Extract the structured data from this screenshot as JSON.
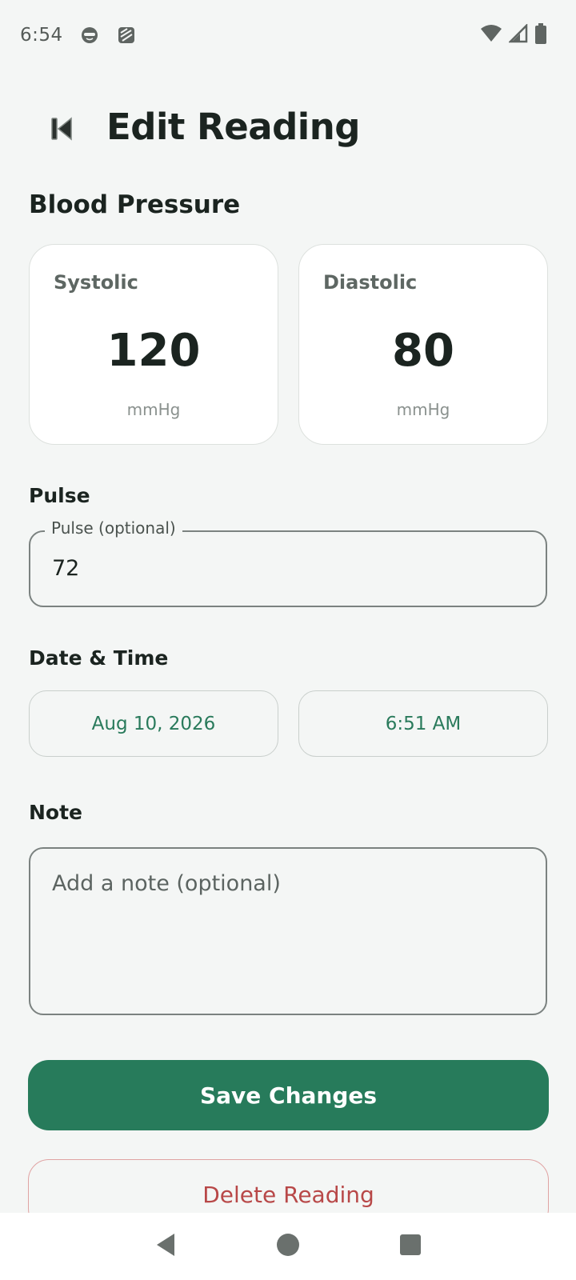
{
  "status_bar": {
    "time": "6:54",
    "notification_icons": [
      "face-notification-icon",
      "stack-notification-icon"
    ],
    "system_icons": [
      "wifi-icon",
      "cell-signal-icon",
      "battery-icon"
    ]
  },
  "header": {
    "back_icon": "skip-back-icon",
    "title": "Edit Reading"
  },
  "blood_pressure": {
    "section_label": "Blood Pressure",
    "systolic": {
      "label": "Systolic",
      "value": "120",
      "unit": "mmHg"
    },
    "diastolic": {
      "label": "Diastolic",
      "value": "80",
      "unit": "mmHg"
    }
  },
  "pulse": {
    "section_label": "Pulse",
    "field_label": "Pulse (optional)",
    "value": "72"
  },
  "date_time": {
    "section_label": "Date & Time",
    "date": "Aug 10, 2026",
    "time": "6:51 AM"
  },
  "note": {
    "section_label": "Note",
    "placeholder": "Add a note (optional)",
    "value": ""
  },
  "actions": {
    "save_label": "Save Changes",
    "delete_label": "Delete Reading"
  },
  "nav_bar": {
    "icons": [
      "back-triangle-icon",
      "home-circle-icon",
      "recents-square-icon"
    ]
  },
  "colors": {
    "accent": "#277b5b",
    "danger": "#b84848",
    "background": "#f4f6f5"
  }
}
